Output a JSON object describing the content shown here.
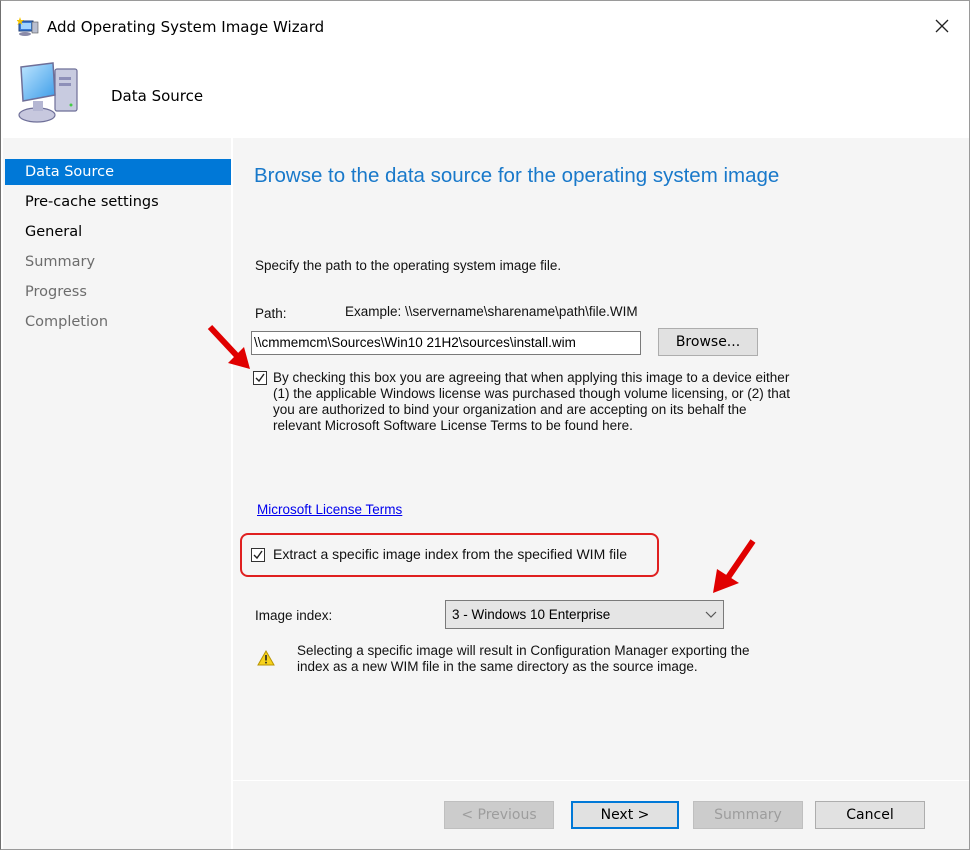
{
  "window": {
    "title": "Add Operating System Image Wizard",
    "icon": "wizard-computer-icon",
    "close_icon": "close-icon"
  },
  "header": {
    "title": "Data Source",
    "icon": "computer-icon"
  },
  "sidebar": {
    "items": [
      {
        "label": "Data Source",
        "state": "active"
      },
      {
        "label": "Pre-cache settings",
        "state": "enabled"
      },
      {
        "label": "General",
        "state": "enabled"
      },
      {
        "label": "Summary",
        "state": "disabled"
      },
      {
        "label": "Progress",
        "state": "disabled"
      },
      {
        "label": "Completion",
        "state": "disabled"
      }
    ]
  },
  "main": {
    "page_title": "Browse to the data source for the operating system image",
    "instruction": "Specify the path to the operating system image file.",
    "path_label": "Path:",
    "path_example": "Example: \\\\servername\\sharename\\path\\file.WIM",
    "path_value": "\\\\cmmemcm\\Sources\\Win10 21H2\\sources\\install.wim",
    "browse_label": "Browse...",
    "license_checkbox": {
      "checked": true,
      "text": "By checking this box you are agreeing that when applying this image to a device either (1) the applicable Windows license was purchased though volume licensing, or (2) that you are authorized to bind your organization and are accepting on its behalf the relevant Microsoft Software License Terms to be found here."
    },
    "license_link": "Microsoft License Terms",
    "extract_checkbox": {
      "checked": true,
      "text": "Extract a specific image index from the specified WIM file"
    },
    "image_index_label": "Image index:",
    "image_index_value": "3 - Windows 10 Enterprise",
    "warning_icon": "warning-icon",
    "warning_text": "Selecting a specific image will result in Configuration Manager exporting the index as a new WIM file in the same directory as the source image."
  },
  "footer": {
    "previous_label": "< Previous",
    "next_label": "Next >",
    "summary_label": "Summary",
    "cancel_label": "Cancel"
  },
  "annotations": {
    "arrow_color": "#e00000",
    "highlight_color": "#e02020"
  },
  "colors": {
    "accent": "#0078d7",
    "title_blue": "#1979ca",
    "link": "#0000ee"
  }
}
